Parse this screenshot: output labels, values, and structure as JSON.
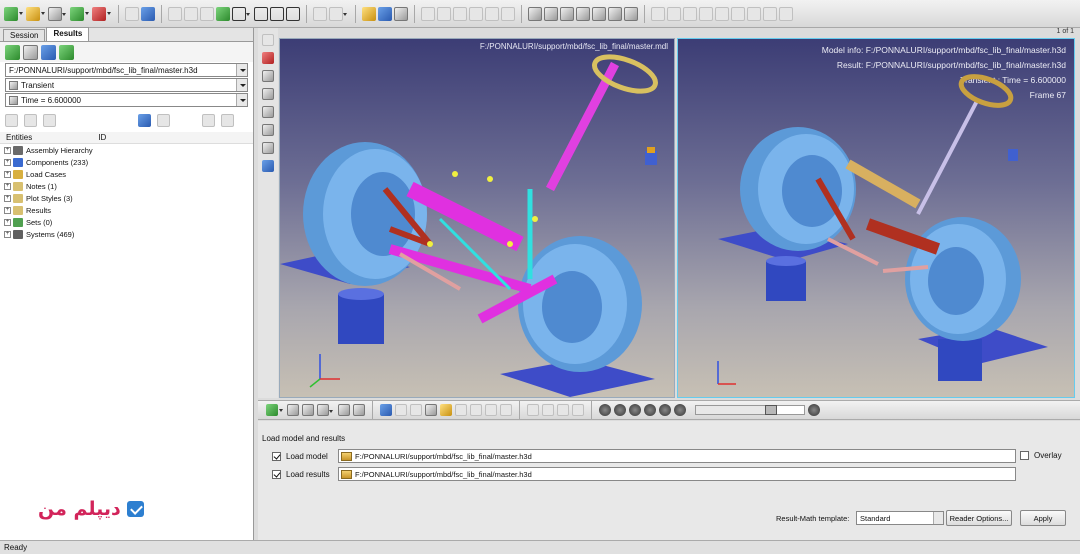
{
  "left_panel": {
    "tabs": [
      {
        "label": "Session"
      },
      {
        "label": "Results"
      }
    ],
    "model_file": "F:/PONNALURI/support/mbd/fsc_lib_final/master.h3d",
    "result_type": "Transient",
    "time": "Time = 6.600000",
    "entities_header": "Entities",
    "id_header": "ID",
    "tree": [
      {
        "label": "Assembly Hierarchy",
        "color": "#6a6a6a"
      },
      {
        "label": "Components (233)",
        "color": "#3a6ad0"
      },
      {
        "label": "Load Cases",
        "color": "#d8b040"
      },
      {
        "label": "Notes (1)",
        "color": "#d8c070"
      },
      {
        "label": "Plot Styles (3)",
        "color": "#d8c070"
      },
      {
        "label": "Results",
        "color": "#d8c070"
      },
      {
        "label": "Sets (0)",
        "color": "#50a050"
      },
      {
        "label": "Systems (469)",
        "color": "#606060"
      }
    ]
  },
  "viewport": {
    "page": "1 of 1",
    "left_path": "F:/PONNALURI/support/mbd/fsc_lib_final/master.mdl",
    "right_info": {
      "model": "Model info: F:/PONNALURI/support/mbd/fsc_lib_final/master.h3d",
      "result": "Result: F:/PONNALURI/support/mbd/fsc_lib_final/master.h3d",
      "transient": "Transient : Time = 6.600000",
      "frame": "Frame 67"
    }
  },
  "animation": {
    "progress": 0.72
  },
  "load_panel": {
    "title": "Load model and results",
    "load_model_label": "Load model",
    "load_model_path": "F:/PONNALURI/support/mbd/fsc_lib_final/master.h3d",
    "load_results_label": "Load results",
    "load_results_path": "F:/PONNALURI/support/mbd/fsc_lib_final/master.h3d",
    "overlay_label": "Overlay",
    "template_label": "Result-Math template:",
    "template_value": "Standard",
    "reader_options": "Reader Options...",
    "apply": "Apply"
  },
  "logo_text": "دیپلم من",
  "status": "Ready"
}
